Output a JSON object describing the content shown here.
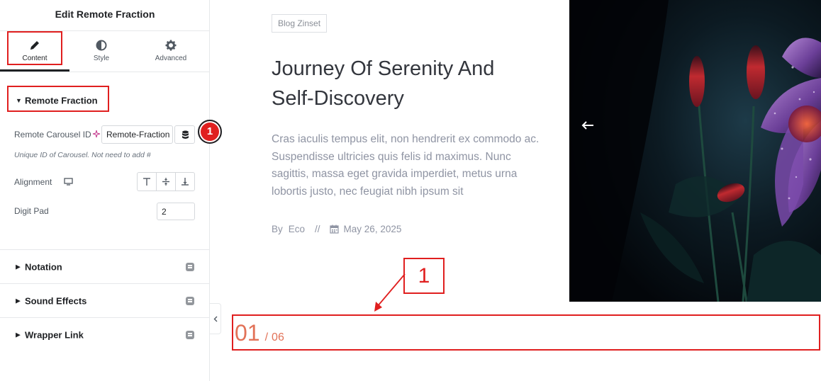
{
  "panel": {
    "title": "Edit Remote Fraction",
    "tabs": [
      {
        "label": "Content",
        "icon": "pencil-icon"
      },
      {
        "label": "Style",
        "icon": "half-circle-icon"
      },
      {
        "label": "Advanced",
        "icon": "gear-icon"
      }
    ],
    "section": {
      "title": "Remote Fraction",
      "carousel_id_label": "Remote Carousel ID",
      "carousel_id_value": "Remote-Fraction",
      "carousel_id_help": "Unique ID of Carousel. Not need to add #",
      "alignment_label": "Alignment",
      "digit_pad_label": "Digit Pad",
      "digit_pad_value": "2"
    },
    "collapsed_sections": [
      {
        "label": "Notation"
      },
      {
        "label": "Sound Effects"
      },
      {
        "label": "Wrapper Link"
      }
    ],
    "badge": "1"
  },
  "preview": {
    "tag": "Blog Zinset",
    "headline": "Journey Of Serenity And Self-Discovery",
    "excerpt": "Cras iaculis tempus elit, non hendrerit ex commodo ac. Suspendisse ultricies quis felis id maximus. Nunc sagittis, massa eget gravida imperdiet, metus urna lobortis justo, nec feugiat nibh ipsum sit",
    "meta_by": "By",
    "meta_author": "Eco",
    "meta_sep": "//",
    "meta_date": "May 26, 2025",
    "fraction_current": "01",
    "fraction_slash": "/",
    "fraction_total": "06",
    "callout_number": "1"
  },
  "colors": {
    "accent": "#e27258",
    "highlight": "#e01f1f"
  }
}
